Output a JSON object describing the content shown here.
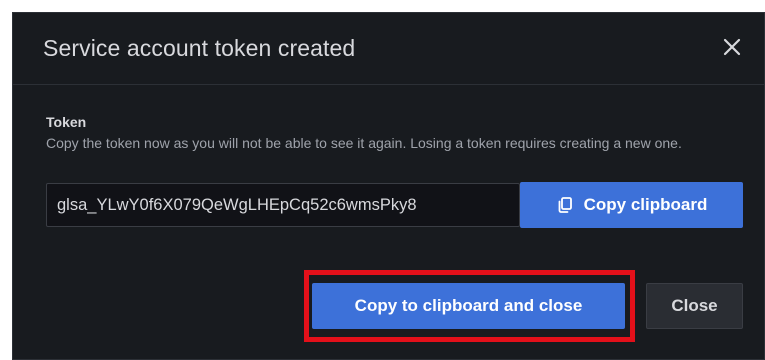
{
  "dialog": {
    "title": "Service account token created",
    "close_icon": "close-icon"
  },
  "token": {
    "label": "Token",
    "description": "Copy the token now as you will not be able to see it again. Losing a token requires creating a new one.",
    "value": "glsa_YLwY0f6X079QeWgLHEpCq52c6wmsPky8",
    "copy_button_label": "Copy clipboard",
    "copy_icon": "copy-icon"
  },
  "footer": {
    "primary_label": "Copy to clipboard and close",
    "close_label": "Close"
  },
  "colors": {
    "modal_bg": "#181b1f",
    "primary": "#3d71d9",
    "highlight": "#e3101a",
    "secondary_bg": "#2a2d33"
  }
}
